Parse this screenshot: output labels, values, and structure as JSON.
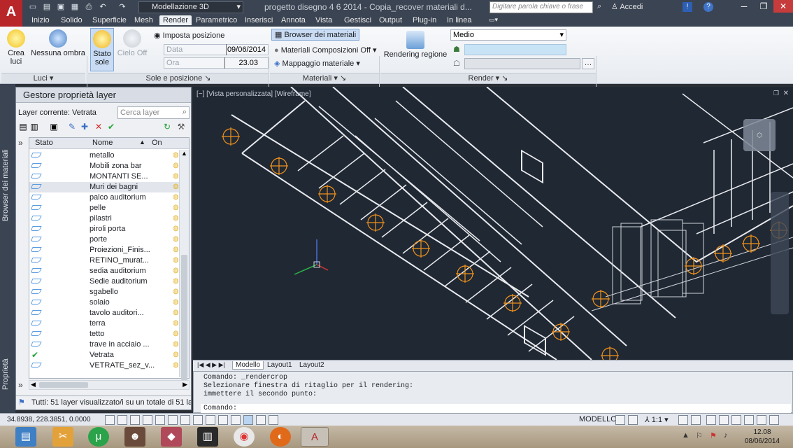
{
  "titlebar": {
    "app_logo": "A",
    "workspace": "Modellazione 3D",
    "document_title": "progetto disegno 4 6 2014 - Copia_recover materiali d...",
    "search_placeholder": "Digitare parola chiave o frase",
    "login": "Accedi"
  },
  "menubar": {
    "items": [
      "Inizio",
      "Solido",
      "Superficie",
      "Mesh",
      "Render",
      "Parametrico",
      "Inserisci",
      "Annota",
      "Vista",
      "Gestisci",
      "Output",
      "Plug-in",
      "In linea"
    ],
    "active": "Render"
  },
  "ribbon": {
    "crea_luci": "Crea\nluci",
    "nessuna_ombra": "Nessuna ombra",
    "luci_panel": "Luci",
    "stato_sole": "Stato\nsole",
    "cielo_off": "Cielo Off",
    "imposta_posizione": "Imposta posizione",
    "data_label": "Data",
    "data_value": "09/06/2014",
    "ora_label": "Ora",
    "ora_value": "23.03",
    "sole_panel": "Sole e posizione",
    "browser_materiali": "Browser dei materiali",
    "materiali_composizioni": "Materiali Composizioni Off",
    "mappaggio_materiale": "Mappaggio materiale",
    "materiali_panel": "Materiali",
    "rendering_regione": "Rendering regione",
    "quality": "Medio",
    "render_panel": "Render"
  },
  "side_tabs": {
    "materials": "Browser dei materiali",
    "properties": "Proprietà"
  },
  "layer_palette": {
    "title": "Gestore proprietà layer",
    "current_layer": "Layer corrente: Vetrata",
    "search_placeholder": "Cerca layer",
    "col_state": "Stato",
    "col_name": "Nome",
    "col_on": "On",
    "layers": [
      {
        "name": "metallo",
        "current": false
      },
      {
        "name": "Mobili zona bar",
        "current": false
      },
      {
        "name": "MONTANTI SE...",
        "current": false
      },
      {
        "name": "Muri dei bagni",
        "current": false
      },
      {
        "name": "palco auditorium",
        "current": false
      },
      {
        "name": "pelle",
        "current": false
      },
      {
        "name": "pilastri",
        "current": false
      },
      {
        "name": "piroli porta",
        "current": false
      },
      {
        "name": "porte",
        "current": false
      },
      {
        "name": "Proiezioni_Finis...",
        "current": false
      },
      {
        "name": "RETINO_murat...",
        "current": false
      },
      {
        "name": "sedia auditorium",
        "current": false
      },
      {
        "name": "Sedie auditorium",
        "current": false
      },
      {
        "name": "sgabello",
        "current": false
      },
      {
        "name": "solaio",
        "current": false
      },
      {
        "name": "tavolo auditori...",
        "current": false
      },
      {
        "name": "terra",
        "current": false
      },
      {
        "name": "tetto",
        "current": false
      },
      {
        "name": "trave in acciaio ...",
        "current": false
      },
      {
        "name": "Vetrata",
        "current": true
      },
      {
        "name": "VETRATE_sez_v...",
        "current": false
      }
    ],
    "status": "Tutti: 51 layer visualizzato/i su un totale di 51 la"
  },
  "viewport": {
    "label": "[−] [Vista personalizzata] [Wireframe]"
  },
  "layout_tabs": [
    "Modello",
    "Layout1",
    "Layout2"
  ],
  "command": {
    "history": [
      "Comando: _rendercrop",
      "Selezionare finestra di ritaglio per il rendering:",
      "immettere il secondo punto:"
    ],
    "prompt": "Comando:"
  },
  "statusbar": {
    "coords": "34.8938, 228.3851, 0.0000",
    "model": "MODELLO",
    "scale": "1:1"
  },
  "taskbar": {
    "time": "12.08",
    "date": "08/06/2014"
  },
  "colors": {
    "accent": "#3b4452",
    "wire": "#ffffff",
    "light_marker": "#f0921c",
    "viewport_bg": "#202833"
  }
}
